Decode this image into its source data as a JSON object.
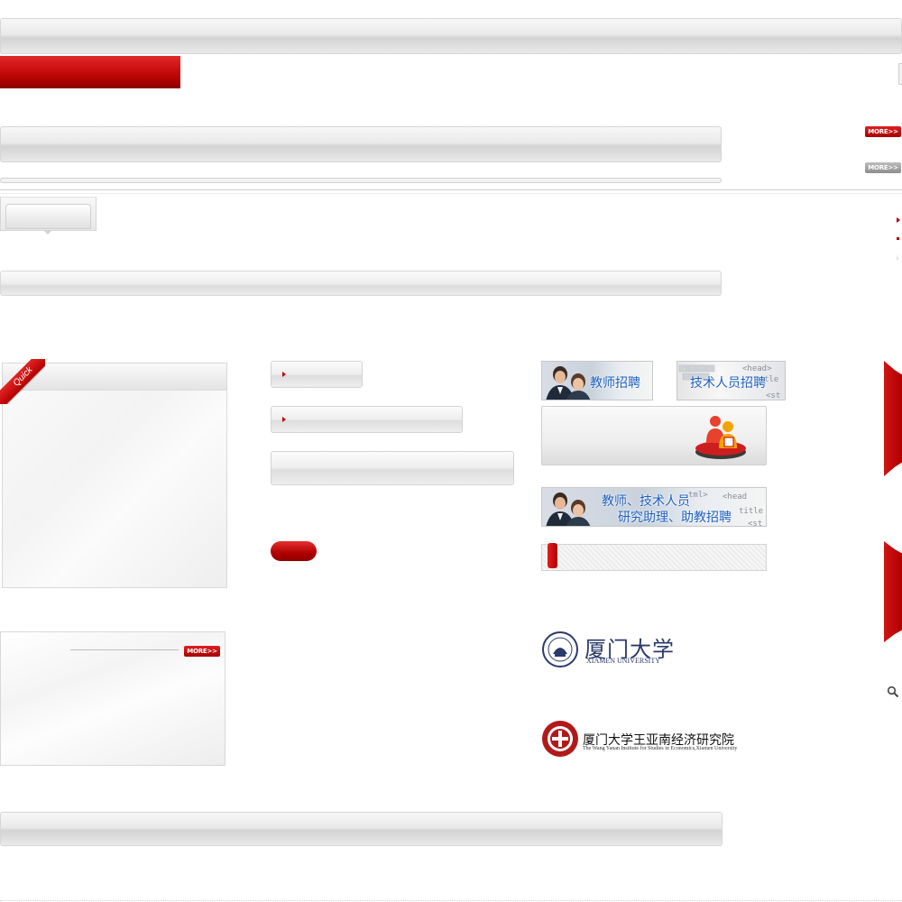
{
  "header": {
    "more_label": "MORE>>"
  },
  "quick_links": {
    "ribbon_label": "Quick"
  },
  "recruitment": {
    "teacher_banner": "教师招聘",
    "tech_banner": "技术人员招聘",
    "combined_banner_line1": "教师、技术人员",
    "combined_banner_line2": "研究助理、助教招聘"
  },
  "logos": {
    "xmu_cn": "厦门大学",
    "xmu_en": "XIAMEN UNIVERSITY",
    "wise_cn": "厦门大学王亚南经济研究院",
    "wise_en": "The Wang Yanan Institute for Studies in Economics,Xiamen University"
  },
  "colors": {
    "accent_red": "#c00000",
    "teacher_banner_text": "#1d5fbf",
    "bar_gray": "#e2e2e2"
  },
  "icons": {
    "search": "search-icon"
  }
}
